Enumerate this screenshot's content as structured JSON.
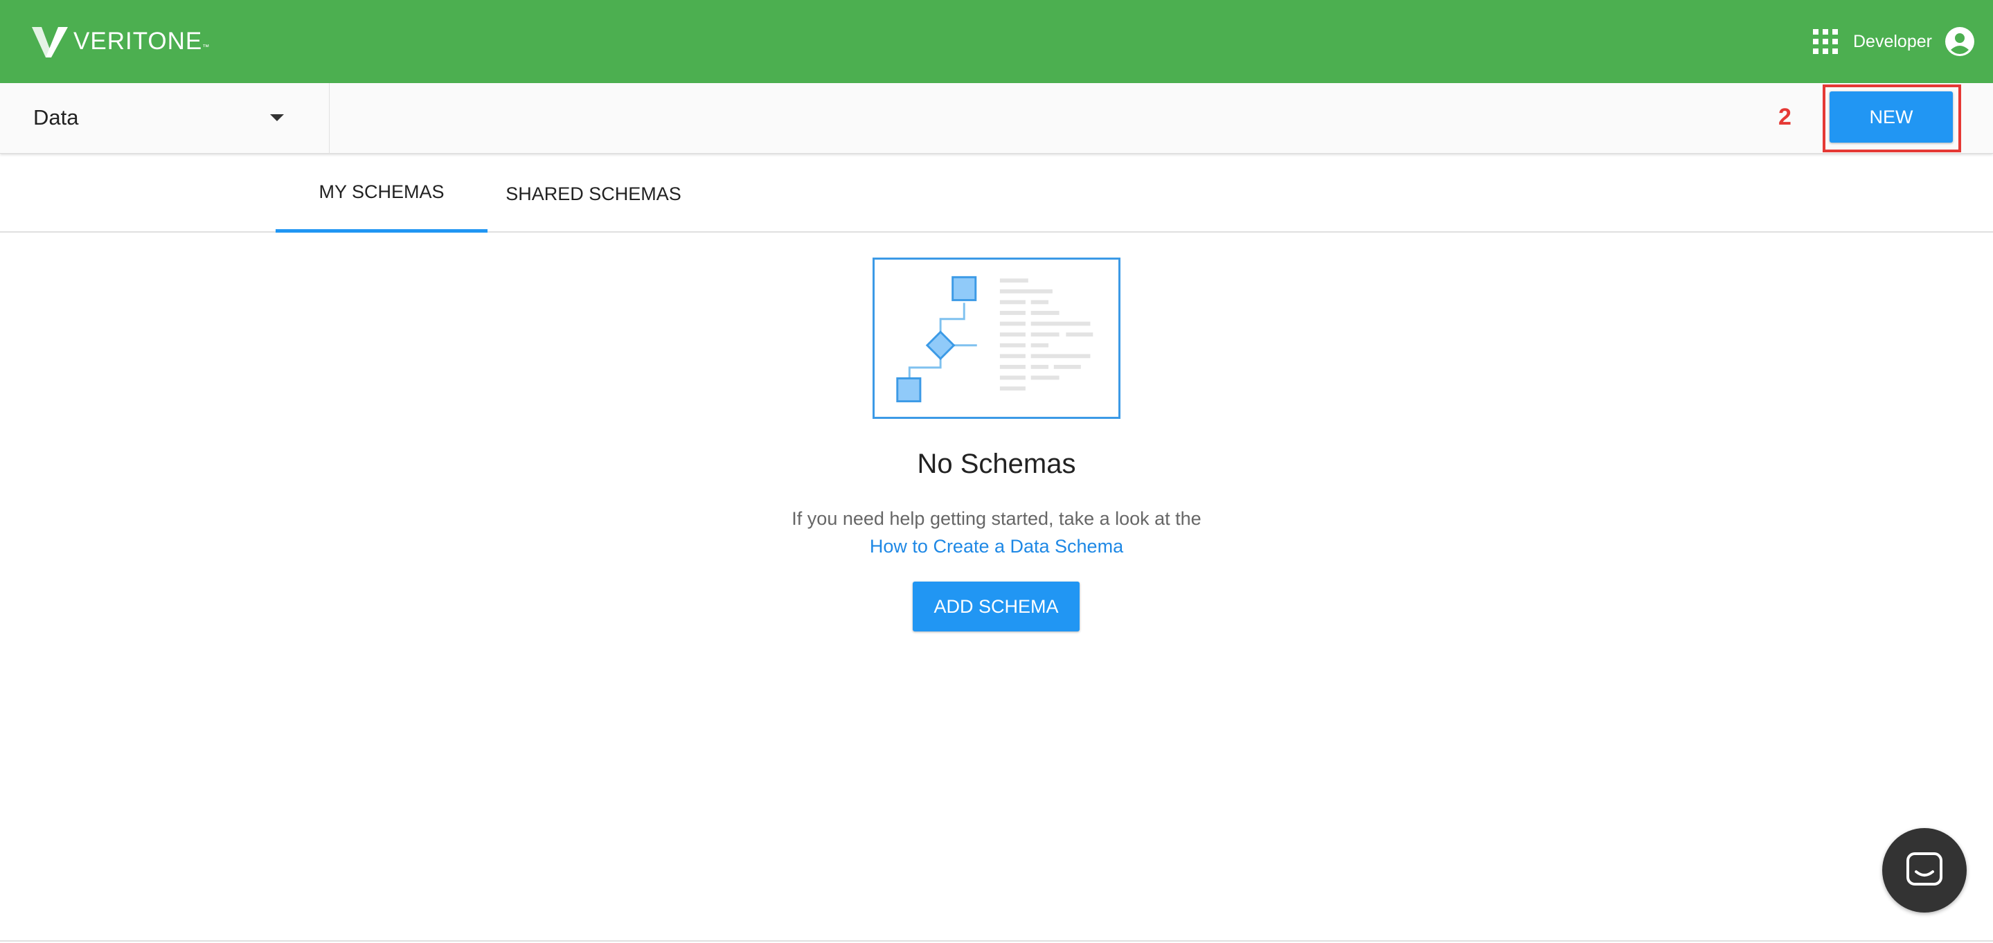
{
  "app": {
    "brand": "VERITONE",
    "brand_mark": "™"
  },
  "header": {
    "user_label": "Developer",
    "apps_icon": "apps-grid-icon",
    "user_icon": "account-circle-icon"
  },
  "toolbar": {
    "section_selected": "Data",
    "step_marker": "2",
    "new_label": "NEW"
  },
  "tabs": [
    {
      "label": "MY SCHEMAS",
      "active": true
    },
    {
      "label": "SHARED SCHEMAS",
      "active": false
    }
  ],
  "empty_state": {
    "title": "No Schemas",
    "help_text": "If you need help getting started, take a look at the",
    "link_text": "How to Create a Data Schema",
    "button_label": "ADD SCHEMA"
  },
  "colors": {
    "header": "#4caf50",
    "primary": "#2196f3",
    "annotation": "#e53935",
    "link": "#1e88e5"
  }
}
